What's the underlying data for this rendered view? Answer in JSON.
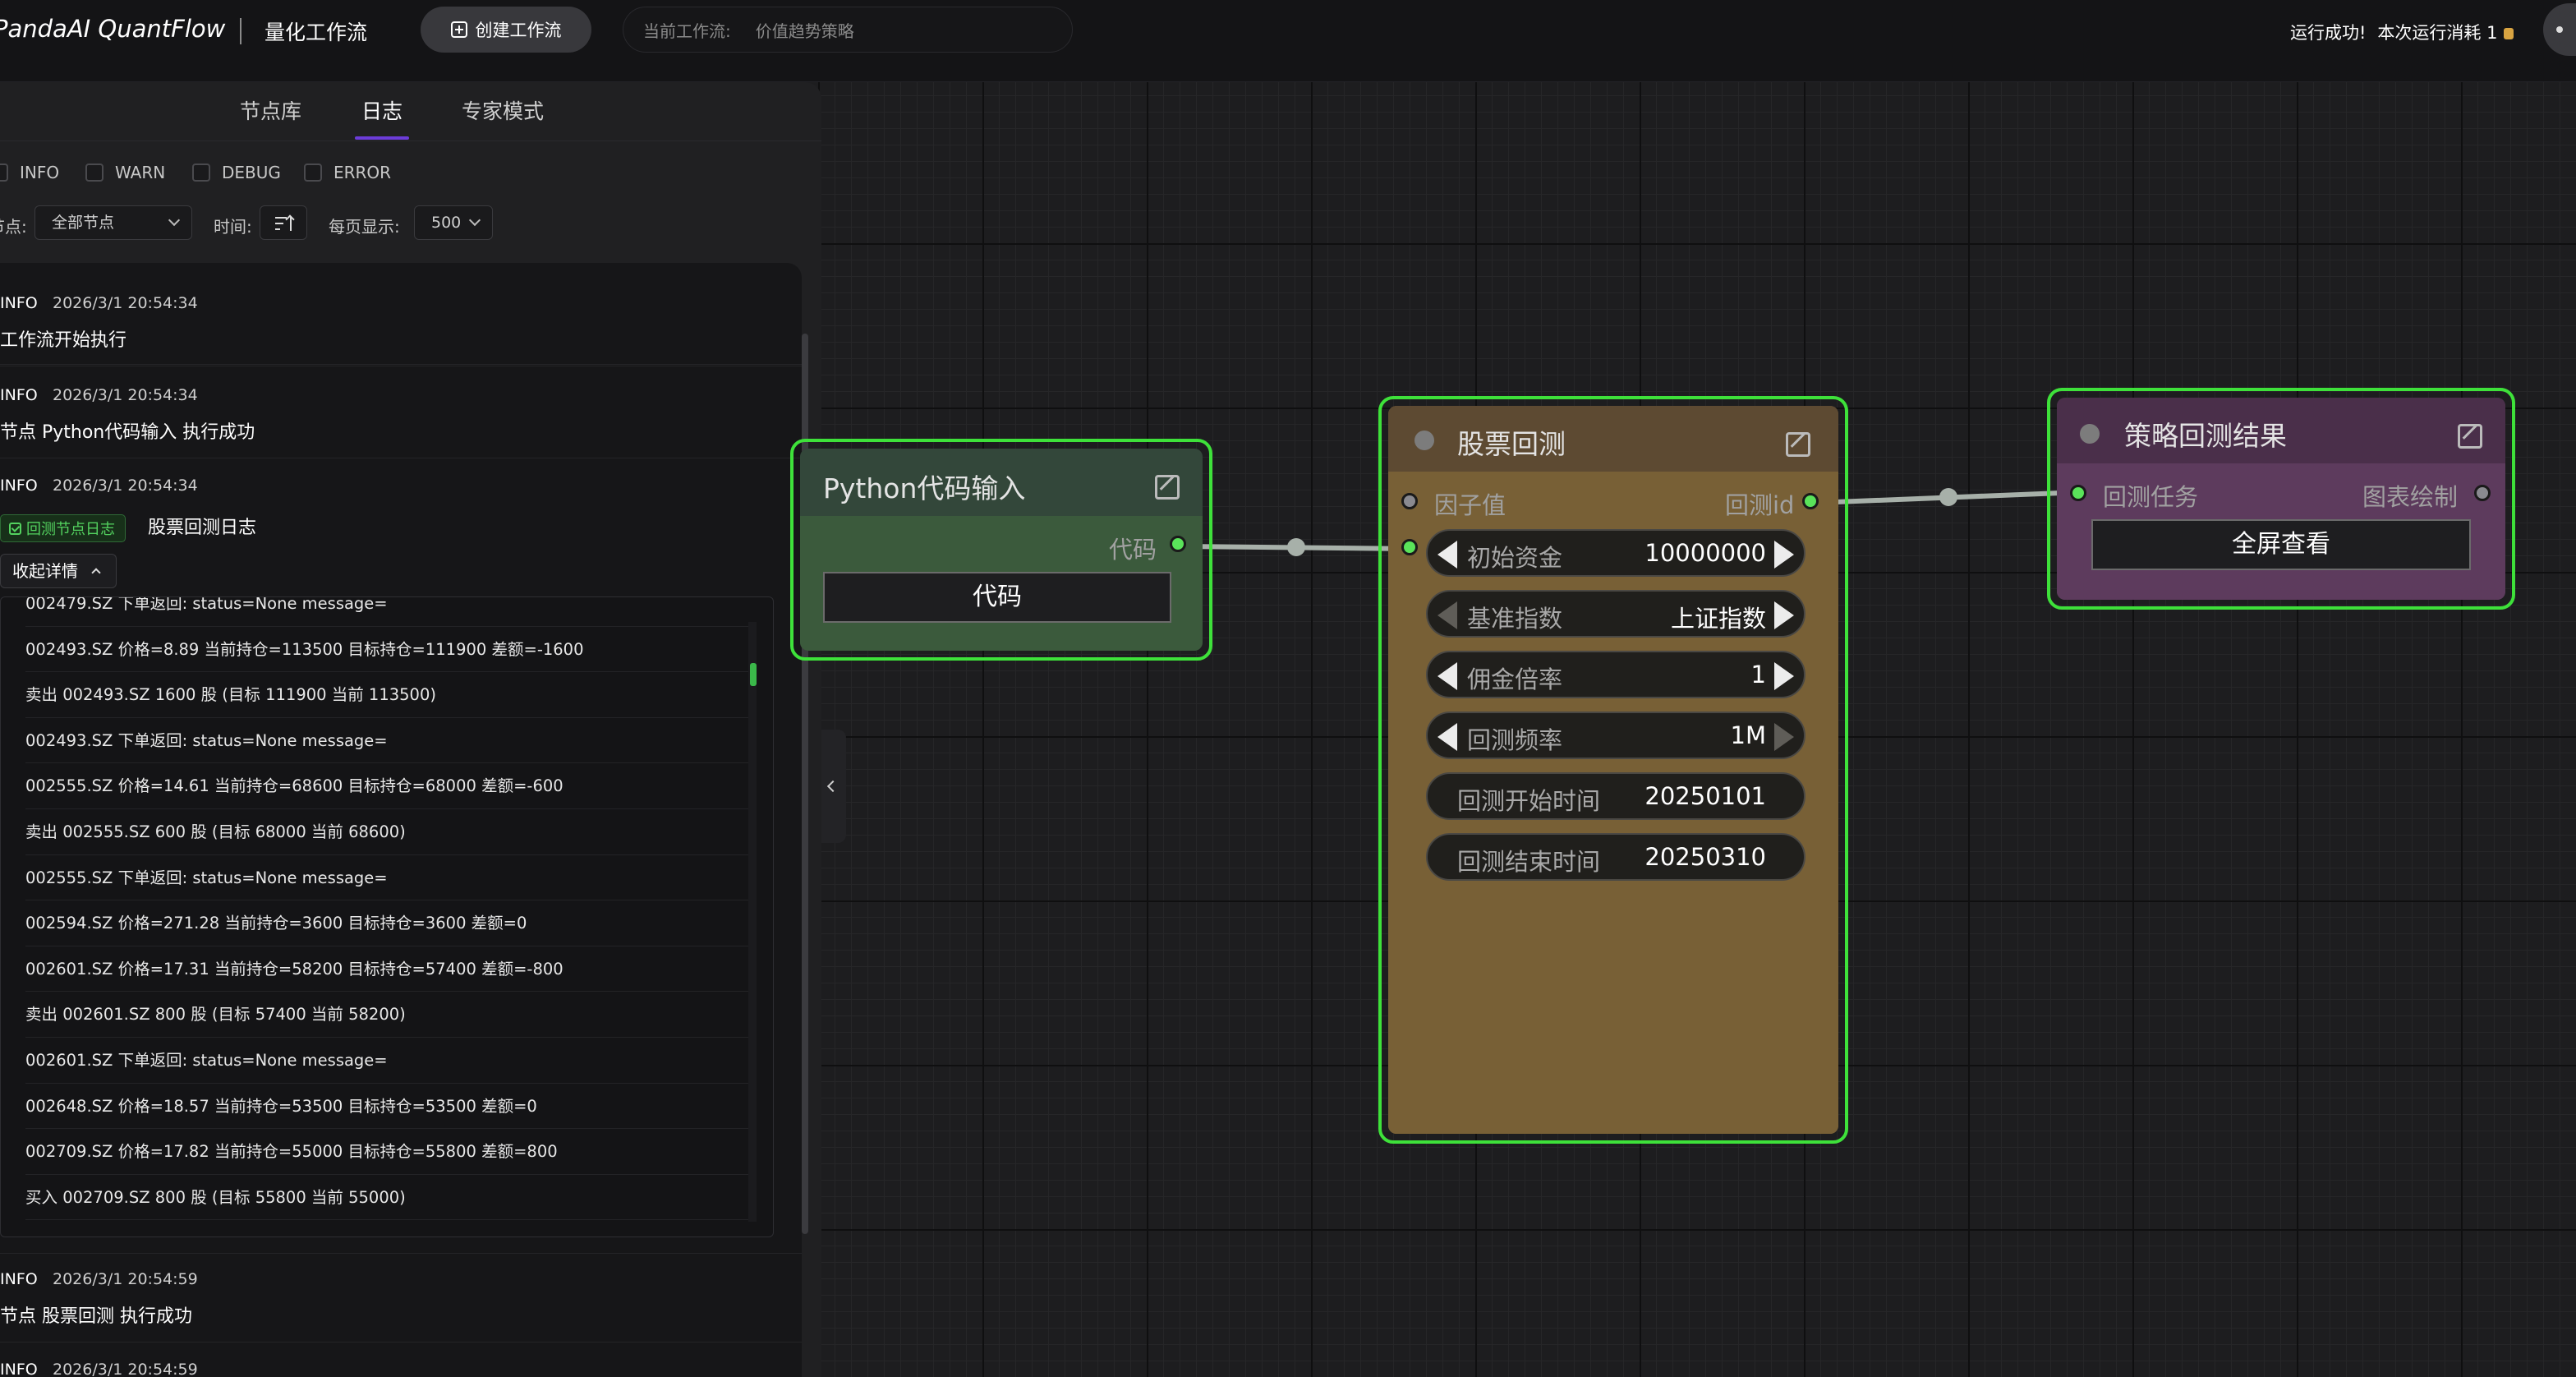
{
  "header": {
    "brand": "PandaAI QuantFlow",
    "subtitle": "量化工作流",
    "create_button": "创建工作流",
    "current_label": "当前工作流:",
    "current_value": "价值趋势策略",
    "run_status": "运行成功!",
    "run_cost": "本次运行消耗 1"
  },
  "panel": {
    "tabs": [
      "节点库",
      "日志",
      "专家模式"
    ],
    "active_tab": "日志",
    "levels": [
      "INFO",
      "WARN",
      "DEBUG",
      "ERROR"
    ],
    "node_label": "节点:",
    "node_value": "全部节点",
    "time_label": "时间:",
    "page_label": "每页显示:",
    "page_value": "500",
    "collapse_label": "收起详情",
    "toggle": "‹"
  },
  "logs": [
    {
      "level": "INFO",
      "time": "2026/3/1 20:54:34",
      "message": "工作流开始执行"
    },
    {
      "level": "INFO",
      "time": "2026/3/1 20:54:34",
      "message": "节点 Python代码输入 执行成功"
    },
    {
      "level": "INFO",
      "time": "2026/3/1 20:54:34",
      "badge": "回测节点日志",
      "message": "股票回测日志"
    },
    {
      "level": "INFO",
      "time": "2026/3/1 20:54:59",
      "message": "节点 股票回测 执行成功"
    },
    {
      "level": "INFO",
      "time": "2026/3/1 20:54:59",
      "message": ""
    }
  ],
  "detail_lines": [
    "002479.SZ 下单返回: status=None message=",
    "002493.SZ 价格=8.89 当前持仓=113500 目标持仓=111900 差额=-1600",
    "卖出 002493.SZ 1600 股 (目标 111900 当前 113500)",
    "002493.SZ 下单返回: status=None message=",
    "002555.SZ 价格=14.61 当前持仓=68600 目标持仓=68000 差额=-600",
    "卖出 002555.SZ 600 股 (目标 68000 当前 68600)",
    "002555.SZ 下单返回: status=None message=",
    "002594.SZ 价格=271.28 当前持仓=3600 目标持仓=3600 差额=0",
    "002601.SZ 价格=17.31 当前持仓=58200 目标持仓=57400 差额=-800",
    "卖出 002601.SZ 800 股 (目标 57400 当前 58200)",
    "002601.SZ 下单返回: status=None message=",
    "002648.SZ 价格=18.57 当前持仓=53500 目标持仓=53500 差额=0",
    "002709.SZ 价格=17.82 当前持仓=55000 目标持仓=55800 差额=800",
    "买入 002709.SZ 800 股 (目标 55800 当前 55000)"
  ],
  "nodes": {
    "python": {
      "title": "Python代码输入",
      "output": "代码",
      "button": "代码",
      "color": "#3b5238"
    },
    "backtest": {
      "title": "股票回测",
      "in_port": "因子值",
      "out_port": "回测id",
      "fields": [
        {
          "label": "初始资金",
          "value": "10000000"
        },
        {
          "label": "基准指数",
          "value": "上证指数"
        },
        {
          "label": "佣金倍率",
          "value": "1"
        },
        {
          "label": "回测频率",
          "value": "1M"
        },
        {
          "label": "回测开始时间",
          "value": "20250101"
        },
        {
          "label": "回测结束时间",
          "value": "20250310"
        }
      ],
      "color": "#735c35"
    },
    "result": {
      "title": "策略回测结果",
      "in_port": "回测任务",
      "out_port": "图表绘制",
      "button": "全屏查看",
      "color": "#5a3a5a"
    }
  },
  "colors": {
    "selection": "#3ee13a",
    "port_on": "#5ae35a",
    "tab_accent": "#6c3cd9"
  }
}
